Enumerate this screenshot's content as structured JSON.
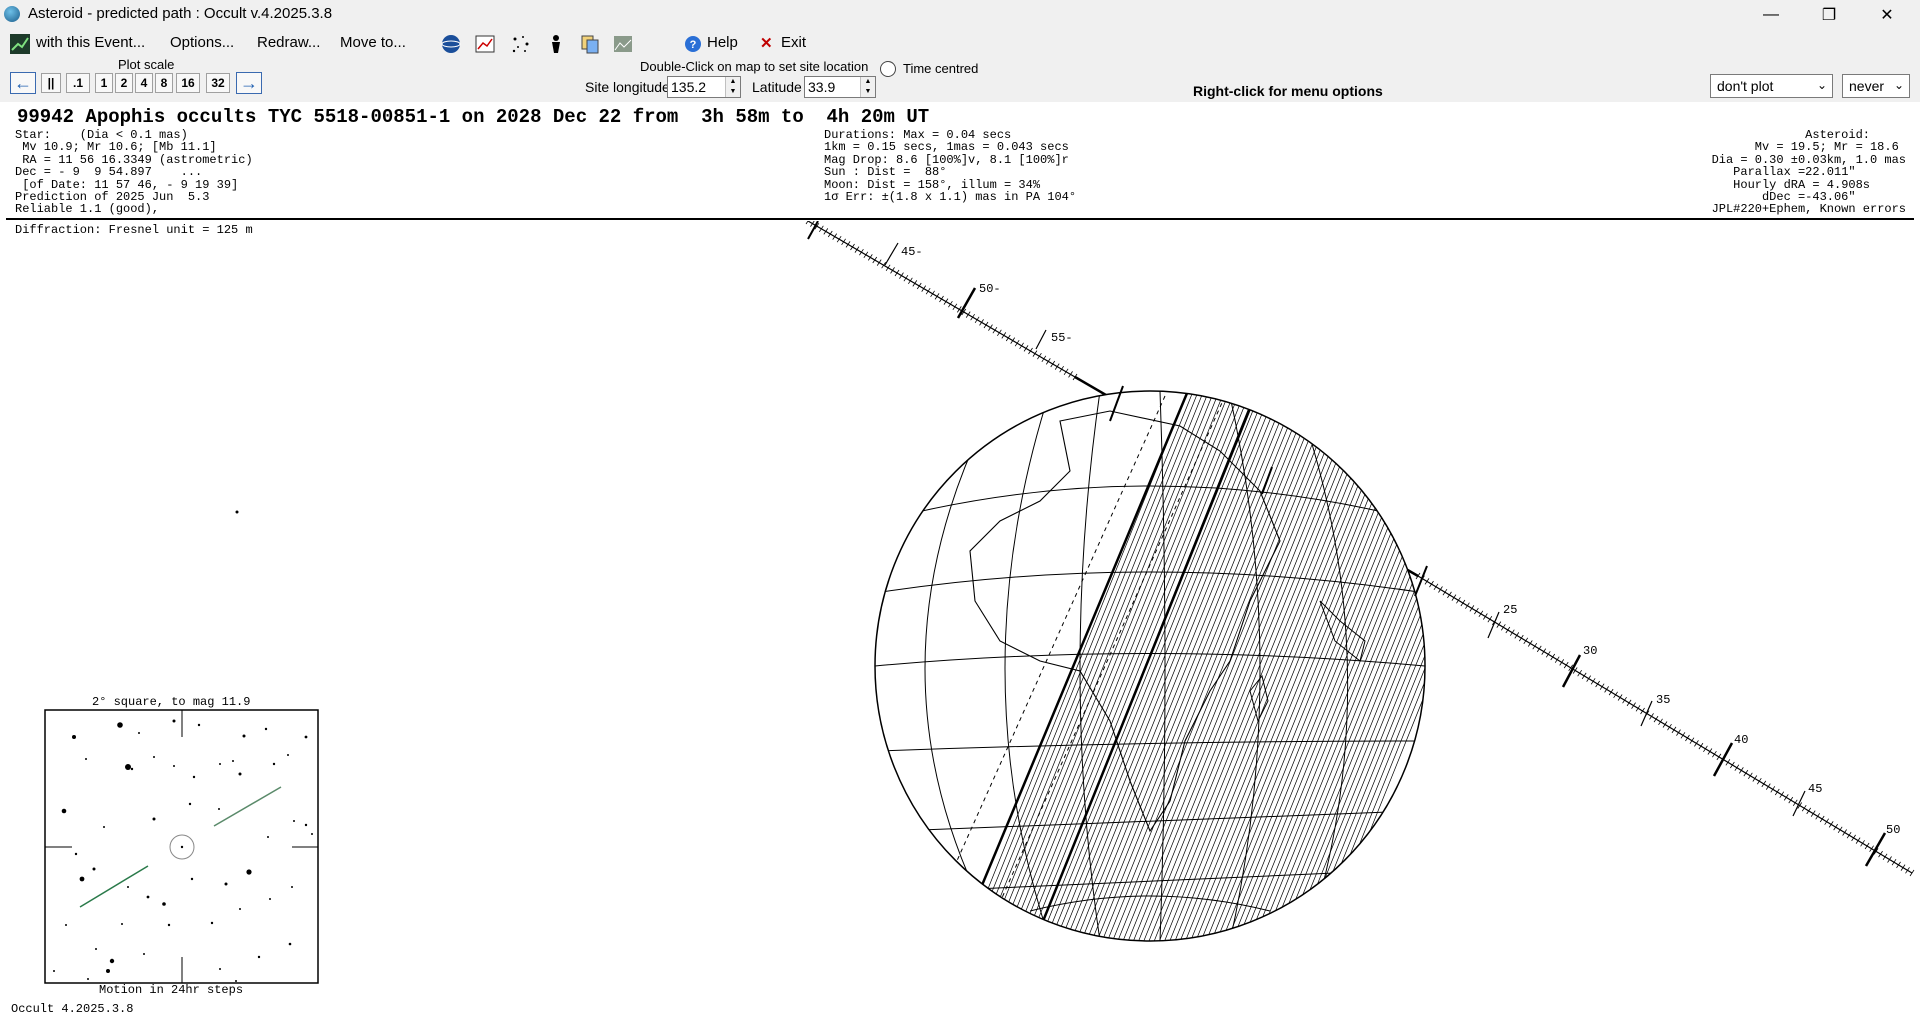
{
  "window": {
    "title": "Asteroid - predicted path : Occult v.4.2025.3.8",
    "minimize": "—",
    "maximize": "❐",
    "close": "✕"
  },
  "menu": {
    "with_event": "with this Event...",
    "options": "Options...",
    "redraw": "Redraw...",
    "move_to": "Move to...",
    "help": "Help",
    "exit": "Exit"
  },
  "controls": {
    "plot_scale_label": "Plot scale",
    "scale_buttons": [
      ".1",
      "1",
      "2",
      "4",
      "8",
      "16",
      "32"
    ],
    "double_click_hint": "Double-Click on map to set site location",
    "time_centred": "Time centred",
    "site_longitude_label": "Site longitude",
    "site_longitude": "135.2",
    "latitude_label": "Latitude",
    "latitude": "33.9",
    "right_click_hint": "Right-click for menu options",
    "plot_option": "don't plot",
    "when_option": "never"
  },
  "event": {
    "headline": "99942 Apophis occults TYC 5518-00851-1 on 2028 Dec 22 from  3h 58m to  4h 20m UT",
    "star_lines": [
      "Star:    (Dia < 0.1 mas)",
      " Mv 10.9; Mr 10.6; [Mb 11.1]",
      " RA = 11 56 16.3349 (astrometric)",
      "Dec = - 9  9 54.897    ...",
      " [of Date: 11 57 46, - 9 19 39]",
      "Prediction of 2025 Jun  5.3",
      "Reliable 1.1 (good),"
    ],
    "mid_lines": [
      "Durations: Max = 0.04 secs",
      "1km = 0.15 secs, 1mas = 0.043 secs",
      "Mag Drop: 8.6 [100%]v, 8.1 [100%]r",
      "Sun : Dist =  88°",
      "Moon: Dist = 158°, illum = 34%",
      "1σ Err: ±(1.8 x 1.1) mas in PA 104°"
    ],
    "right_lines": [
      "Asteroid:     ",
      "Mv = 19.5; Mr = 18.6 ",
      "Dia = 0.30 ±0.03km, 1.0 mas",
      "Parallax =22.011\"       ",
      "Hourly dRA = 4.908s     ",
      "dDec =-43.06\"       ",
      "JPL#220+Ephem, Known errors"
    ],
    "diffraction": "Diffraction: Fresnel unit = 125 m"
  },
  "map": {
    "upper_ticks": [
      "45-",
      "50-",
      "55-"
    ],
    "lower_ticks": [
      "25",
      "30",
      "35",
      "40",
      "45",
      "50"
    ]
  },
  "finder": {
    "title": "2° square, to mag 11.9",
    "caption": "Motion in 24hr steps"
  },
  "footer": {
    "version": "Occult 4.2025.3.8"
  }
}
